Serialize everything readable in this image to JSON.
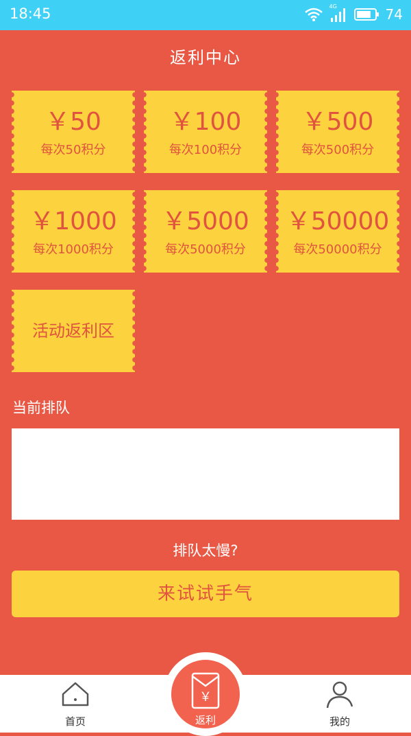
{
  "status_bar": {
    "time": "18:45",
    "network": "4G",
    "battery": "74"
  },
  "page": {
    "title": "返利中心"
  },
  "tickets": [
    {
      "amount": "￥50",
      "desc": "每次50积分"
    },
    {
      "amount": "￥100",
      "desc": "每次100积分"
    },
    {
      "amount": "￥500",
      "desc": "每次500积分"
    },
    {
      "amount": "￥1000",
      "desc": "每次1000积分"
    },
    {
      "amount": "￥5000",
      "desc": "每次5000积分"
    },
    {
      "amount": "￥50000",
      "desc": "每次50000积分"
    }
  ],
  "activity": {
    "label": "活动返利区"
  },
  "queue": {
    "label": "当前排队"
  },
  "prompt": {
    "text": "排队太慢?"
  },
  "action": {
    "label": "来试试手气"
  },
  "tabbar": {
    "home": "首页",
    "rebate": "返利",
    "rebate_symbol": "￥",
    "me": "我的"
  },
  "colors": {
    "background": "#e85844",
    "ticket": "#fcd33f",
    "status_bar": "#3fd1f5",
    "accent_text": "#e0533f"
  }
}
